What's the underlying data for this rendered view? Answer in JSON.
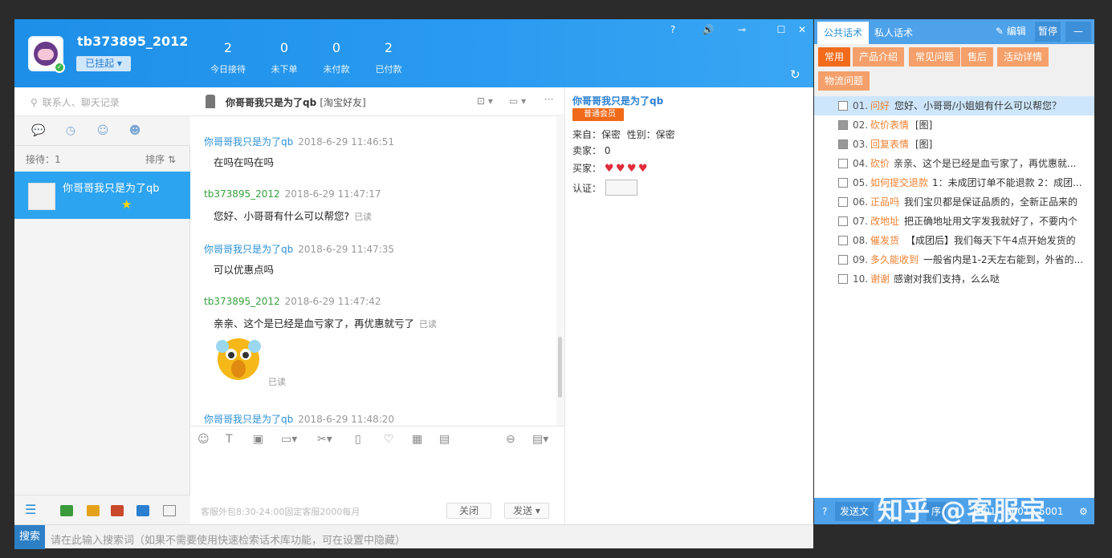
{
  "header": {
    "username": "tb373895_2012",
    "status": "已挂起 ▾",
    "stats": [
      {
        "value": "2",
        "label": "今日接待"
      },
      {
        "value": "0",
        "label": "未下单"
      },
      {
        "value": "0",
        "label": "未付款"
      },
      {
        "value": "2",
        "label": "已付款"
      }
    ],
    "window_buttons": [
      "?",
      "🔊",
      "⊸",
      "☐",
      "✕"
    ]
  },
  "left": {
    "search_placeholder": "联系人、聊天记录",
    "waiting": "接待：1",
    "sort": "排序 ⇅",
    "conversation": {
      "name": "你哥哥我只是为了qb"
    }
  },
  "chat": {
    "title": "你哥哥我只是为了qb",
    "title_tag": "[淘宝好友]",
    "messages": [
      {
        "sender": "你哥哥我只是为了qb",
        "time": "2018-6-29 11:46:51",
        "text": "在吗在吗在吗",
        "read": ""
      },
      {
        "sender": "tb373895_2012",
        "time": "2018-6-29 11:47:17",
        "text": "您好、小哥哥有什么可以帮您?",
        "read": "已读"
      },
      {
        "sender": "你哥哥我只是为了qb",
        "time": "2018-6-29 11:47:35",
        "text": "可以优惠点吗",
        "read": ""
      },
      {
        "sender": "tb373895_2012",
        "time": "2018-6-29 11:47:42",
        "text": "亲亲、这个是已经是血亏家了，再优惠就亏了",
        "read": "已读"
      },
      {
        "sender": "",
        "time": "",
        "text": "",
        "read": "已读"
      },
      {
        "sender": "你哥哥我只是为了qb",
        "time": "2018-6-29 11:48:20",
        "text": "",
        "read": ""
      }
    ],
    "footer_text": "客服外包8:30-24:00固定客服2000每月",
    "close_label": "关闭",
    "send_label": "发送 ▾"
  },
  "info": {
    "name": "你哥哥我只是为了qb",
    "badge": "普通会员",
    "from": "来自：保密",
    "gender": "性别：保密",
    "seller": "卖家：",
    "seller_value": "0",
    "buyer": "买家：",
    "cert": "认证："
  },
  "searchbar": {
    "label": "搜索",
    "placeholder": "请在此输入搜索词（如果不需要使用快速检索话术库功能，可在设置中隐藏）"
  },
  "right": {
    "tabs": [
      "公共话术",
      "私人话术"
    ],
    "edit": "编辑",
    "pause": "暂停",
    "minimize": "—",
    "categories": [
      "常用",
      "产品介绍",
      "常见问题",
      "售后",
      "活动详情",
      "物流问题"
    ],
    "items": [
      {
        "num": "01.",
        "kw": "问好",
        "text": "您好、小哥哥/小姐姐有什么可以帮您？"
      },
      {
        "num": "02.",
        "kw": "砍价表情",
        "text": "[图]"
      },
      {
        "num": "03.",
        "kw": "回复表情",
        "text": "[图]"
      },
      {
        "num": "04.",
        "kw": "砍价",
        "text": "亲亲、这个是已经是血亏家了，再优惠就..."
      },
      {
        "num": "05.",
        "kw": "如何提交退款",
        "text": "1：未成团订单不能退款 2：成团..."
      },
      {
        "num": "06.",
        "kw": "正品吗",
        "text": "我们宝贝都是保证品质的，全新正品来的"
      },
      {
        "num": "07.",
        "kw": "改地址",
        "text": "把正确地址用文字发我就好了，不要内个"
      },
      {
        "num": "08.",
        "kw": "催发货",
        "text": "【成团后】我们每天下午4点开始发货的"
      },
      {
        "num": "09.",
        "kw": "多久能收到",
        "text": "一般省内是1-2天左右能到，外省的..."
      },
      {
        "num": "10.",
        "kw": "谢谢",
        "text": "感谢对我们支持，么么哒"
      }
    ],
    "footer": {
      "send": "发送文",
      "other": "序",
      "info": "1001 · 3001 · 5001"
    }
  },
  "watermark": "知乎 @客服宝"
}
